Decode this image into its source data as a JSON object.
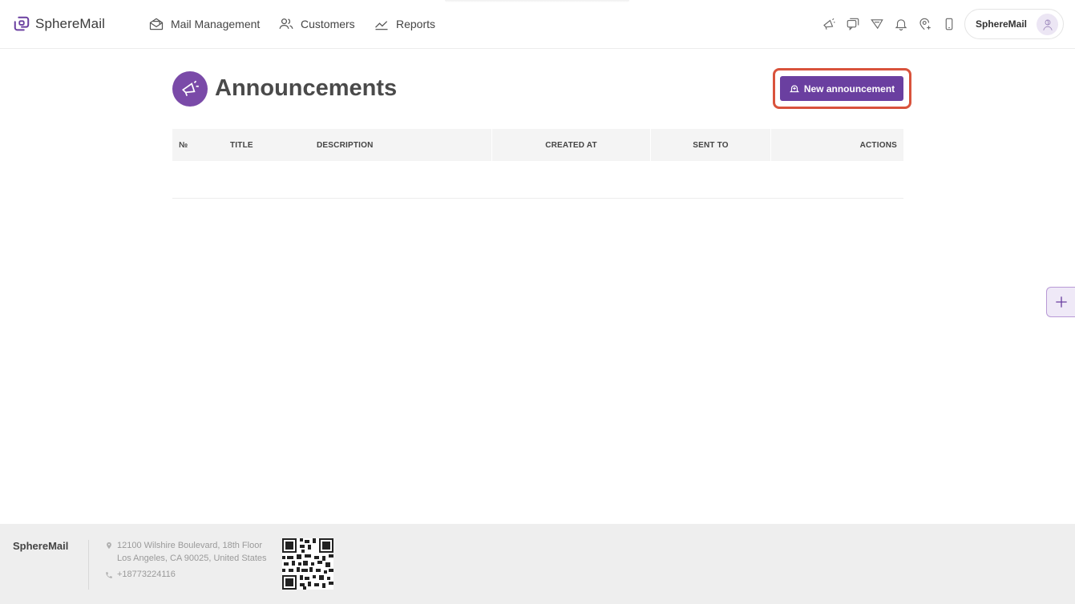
{
  "brand": {
    "name_prefix": "Sphere",
    "name_suffix": "Mail",
    "color": "#6a3fa0"
  },
  "nav": {
    "mail_management": "Mail Management",
    "customers": "Customers",
    "reports": "Reports"
  },
  "toolbar_icons": [
    "megaphone-icon",
    "chat-icon",
    "filter-icon",
    "bell-icon",
    "location-add-icon",
    "mobile-icon"
  ],
  "user": {
    "name": "SphereMail"
  },
  "page": {
    "title": "Announcements",
    "new_button": "New announcement"
  },
  "table": {
    "columns": [
      "№",
      "TITLE",
      "DESCRIPTION",
      "CREATED AT",
      "SENT TO",
      "ACTIONS"
    ],
    "rows": []
  },
  "footer": {
    "brand": "SphereMail",
    "address_line1": "12100 Wilshire Boulevard, 18th Floor",
    "address_line2": "Los Angeles, CA 90025, United States",
    "phone": "+18773224116"
  },
  "colors": {
    "accent": "#6a3fa0",
    "highlight": "#d9533c"
  }
}
